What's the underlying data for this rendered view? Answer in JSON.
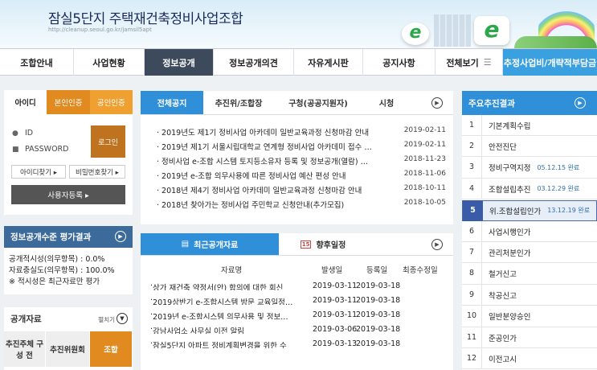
{
  "header": {
    "title": "잠실5단지 주택재건축정비사업조합",
    "url": "http://cleanup.seoul.go.kr/jamsil5apt"
  },
  "nav": {
    "items": [
      "조합안내",
      "사업현황",
      "정보공개",
      "정보공개의견",
      "자유게시판",
      "공지사항",
      "전체보기",
      "추정사업비/개략적부담금"
    ],
    "active": "정보공개"
  },
  "login": {
    "tabs": [
      "아이디",
      "본인인증",
      "공인인증"
    ],
    "id_label": "ID",
    "pw_label": "PASSWORD",
    "login_button": "로그인",
    "find_id": "아이디찾기 ▸",
    "find_pw": "비밀번호찾기 ▸",
    "register": "사용자등록 ▸"
  },
  "evaluation": {
    "title": "정보공개수준 평가결과",
    "lines": [
      "공개적시성(의무항목) : 0.0%",
      "자료충실도(의무항목) : 100.0%",
      "※ 적시성은 최근자료만 평가"
    ]
  },
  "data_room": {
    "title": "공개자료",
    "more": "펼치기",
    "tabs": [
      "추진주체 구성 전",
      "추진위원회",
      "조합"
    ]
  },
  "notice": {
    "tabs": [
      "전체공지",
      "추진위/조합장",
      "구청(공공지원자)",
      "시청"
    ],
    "rows": [
      {
        "title": "2019년도 제1기 정비사업 아카데미 일반교육과정 신청마감 안내",
        "date": "2019-02-11"
      },
      {
        "title": "2019년 제1기 서울시립대학교 연계형 정비사업 아카데미 접수 …",
        "date": "2019-02-11"
      },
      {
        "title": "정비사업 e-조합 시스템 토지등소유자 등록 및 정보공개(열람) …",
        "date": "2018-11-23"
      },
      {
        "title": "2019년 e-조합 의무사용에 따른 정비사업 예산 편성 안내",
        "date": "2018-11-06"
      },
      {
        "title": "2018년 제4기 정비사업 아카데미 일반교육과정 신청마감 안내",
        "date": "2018-10-11"
      },
      {
        "title": "2018년 찾아가는 정비사업 주민학교 신청안내(추가모집)",
        "date": "2018-10-05"
      }
    ]
  },
  "recent": {
    "tabs": [
      "최근공개자료",
      "향후일정"
    ],
    "calendar_num": "15",
    "columns": [
      "자료명",
      "발생일",
      "등록일",
      "최종수정일"
    ],
    "rows": [
      {
        "name": "상가 재건축 약정서(안) 합의에 대한 회신",
        "occurred": "2019-03-11",
        "registered": "2019-03-18",
        "modified": ""
      },
      {
        "name": "2019상반기 e-조합시스템 방문 교육일정…",
        "occurred": "2019-03-11",
        "registered": "2019-03-18",
        "modified": ""
      },
      {
        "name": "2019년 e-조합시스템 의무사용 및 정보…",
        "occurred": "2019-03-11",
        "registered": "2019-03-18",
        "modified": ""
      },
      {
        "name": "강남사업소 사무실 이전 알림",
        "occurred": "2019-03-06",
        "registered": "2019-03-18",
        "modified": ""
      },
      {
        "name": "잠실5단지 아파트 정비계획변경을 위한 수",
        "occurred": "2019-03-13",
        "registered": "2019-03-18",
        "modified": ""
      }
    ]
  },
  "progress": {
    "title": "주요추진결과",
    "items": [
      {
        "num": "1",
        "label": "기본계획수립",
        "date": ""
      },
      {
        "num": "2",
        "label": "안전진단",
        "date": ""
      },
      {
        "num": "3",
        "label": "정비구역지정",
        "date": "05.12.15 완료"
      },
      {
        "num": "4",
        "label": "조합설립추진",
        "date": "03.12.29 완료"
      },
      {
        "num": "5",
        "label": "위.조합설립인가",
        "date": "13.12.19 완료"
      },
      {
        "num": "6",
        "label": "사업시행인가",
        "date": ""
      },
      {
        "num": "7",
        "label": "관리처분인가",
        "date": ""
      },
      {
        "num": "8",
        "label": "철거신고",
        "date": ""
      },
      {
        "num": "9",
        "label": "착공신고",
        "date": ""
      },
      {
        "num": "10",
        "label": "일반분양승인",
        "date": ""
      },
      {
        "num": "11",
        "label": "준공인가",
        "date": ""
      },
      {
        "num": "12",
        "label": "이전고시",
        "date": ""
      }
    ],
    "active_index": 4
  }
}
